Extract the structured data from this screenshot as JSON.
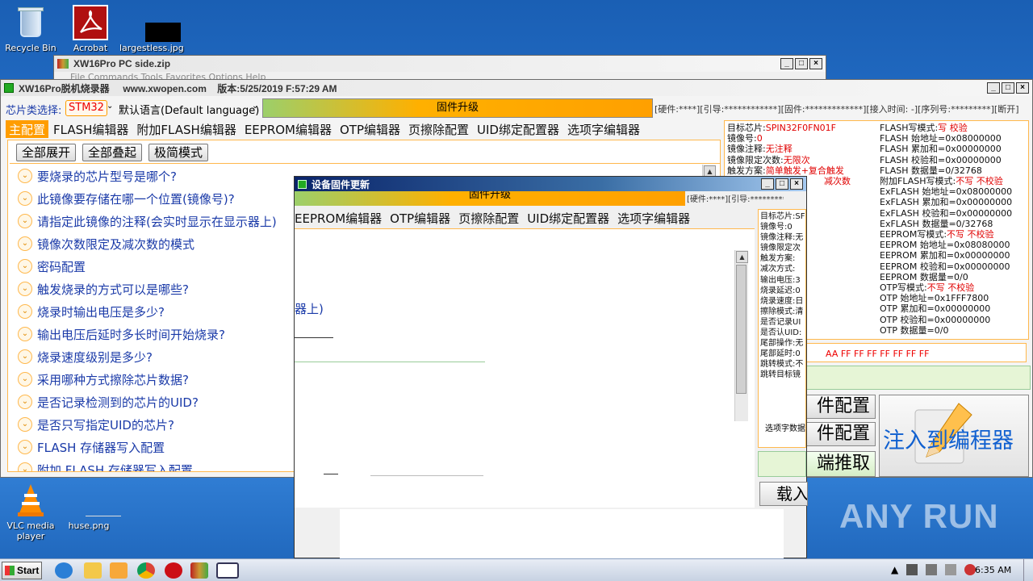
{
  "desktop": {
    "icons": [
      {
        "label": "Recycle Bin"
      },
      {
        "label": "Acrobat"
      },
      {
        "label": "largestless.jpg"
      },
      {
        "label": "VLC media player"
      },
      {
        "label": "huse.png"
      }
    ]
  },
  "zip_window": {
    "title": "XW16Pro PC side.zip",
    "menu_text": "File   Commands   Tools   Favorites   Options   Help"
  },
  "main_window": {
    "title": "XW16Pro脱机烧录器     www.xwopen.com    版本:5/25/2019 F:57:29 AM",
    "chip_type_label": "芯片类选择:",
    "chip_type_value": "STM32",
    "language_label": "默认语言(Default language)",
    "firmware_upgrade_button": "固件升级",
    "hw_info": "[硬件:****][引导:************][固件:*************][接入时间: -][序列号:*********][断开]",
    "tabs": [
      {
        "label": "主配置",
        "active": true
      },
      {
        "label": "FLASH编辑器"
      },
      {
        "label": "附加FLASH编辑器"
      },
      {
        "label": "EEPROM编辑器"
      },
      {
        "label": "OTP编辑器"
      },
      {
        "label": "页擦除配置"
      },
      {
        "label": "UID绑定配置器"
      },
      {
        "label": "选项字编辑器"
      }
    ],
    "buttons": {
      "expand_all": "全部展开",
      "collapse_all": "全部叠起",
      "minimal_mode": "极简模式"
    },
    "questions": [
      "要烧录的芯片型号是哪个?",
      "此镜像要存储在哪一个位置(镜像号)?",
      "请指定此镜像的注释(会实时显示在显示器上)",
      "镜像次数限定及减次数的模式",
      "密码配置",
      "触发烧录的方式可以是哪些?",
      "烧录时输出电压是多少?",
      "输出电压后延时多长时间开始烧录?",
      "烧录速度级别是多少?",
      "采用哪种方式擦除芯片数据?",
      "是否记录检测到的芯片的UID?",
      "是否只写指定UID的芯片?",
      "FLASH 存储器写入配置",
      "附加 FLASH 存储器写入配置"
    ],
    "info_left": [
      {
        "k": "目标芯片:",
        "v": "SPIN32F0FN01F"
      },
      {
        "k": "镜像号:",
        "v": "0"
      },
      {
        "k": "镜像注释:",
        "v": "无注释"
      },
      {
        "k": "镜像限定次数:",
        "v": "无限次"
      },
      {
        "k": "触发方案:",
        "v": "简单触发+复合触发"
      },
      {
        "k": "",
        "v": "减次数"
      }
    ],
    "info_right": [
      {
        "k": "FLASH写模式:",
        "v": "写 校验"
      },
      {
        "k": "FLASH 始地址=",
        "v": "0x08000000"
      },
      {
        "k": "FLASH 累加和=",
        "v": "0x00000000"
      },
      {
        "k": "FLASH 校验和=",
        "v": "0x00000000"
      },
      {
        "k": "FLASH 数据量=",
        "v": "0/32768"
      },
      {
        "k": "附加FLASH写模式:",
        "v": "不写 不校验"
      },
      {
        "k": "ExFLASH 始地址=",
        "v": "0x08000000"
      },
      {
        "k": "ExFLASH 累加和=",
        "v": "0x00000000"
      },
      {
        "k": "ExFLASH 校验和=",
        "v": "0x00000000"
      },
      {
        "k": "ExFLASH 数据量=",
        "v": "0/32768"
      },
      {
        "k": "EEPROM写模式:",
        "v": "不写 不校验"
      },
      {
        "k": "EEPROM 始地址=",
        "v": "0x08080000"
      },
      {
        "k": "EEPROM 累加和=",
        "v": "0x00000000"
      },
      {
        "k": "EEPROM 校验和=",
        "v": "0x00000000"
      },
      {
        "k": "EEPROM 数据量=",
        "v": "0/0"
      },
      {
        "k": "OTP写模式:",
        "v": "不写 不校验"
      },
      {
        "k": "OTP 始地址=",
        "v": "0x1FFF7800"
      },
      {
        "k": "OTP 累加和=",
        "v": "0x00000000"
      },
      {
        "k": "OTP 校验和=",
        "v": "0x00000000"
      },
      {
        "k": "OTP 数据量=",
        "v": "0/0"
      }
    ],
    "option_bytes": "AA FF FF FF FF FF FF FF",
    "side_buttons": {
      "config_a": "件配置",
      "config_b": "件配置",
      "extract": "端推取",
      "inject": "注入到编程器"
    }
  },
  "dialog": {
    "title": "设备固件更新",
    "firmware_button": "固件升级",
    "hw_info": "[硬件:****][引导:*************",
    "tabs": [
      "EEPROM编辑器",
      "OTP编辑器",
      "页擦除配置",
      "UID绑定配置器",
      "选项字编辑器"
    ],
    "right_labels": [
      "目标芯片:SF",
      "镜像号:0",
      "镜像注释:无",
      "镜像限定次",
      "触发方案:",
      "减次方式:",
      "输出电压:3",
      "烧录延迟:0",
      "烧录速度:日",
      "擦除模式:清",
      "是否记录UI",
      "是否认UID:",
      "尾部操作:无",
      "尾部延时:0",
      "跳转模式:不",
      "跳转目标镜"
    ],
    "option_label": "选项字数据",
    "partial_text": "器上)",
    "partial_button": "载入"
  },
  "taskbar": {
    "start_label": "Start",
    "clock": "6:35 AM"
  },
  "watermark": "ANY RUN"
}
